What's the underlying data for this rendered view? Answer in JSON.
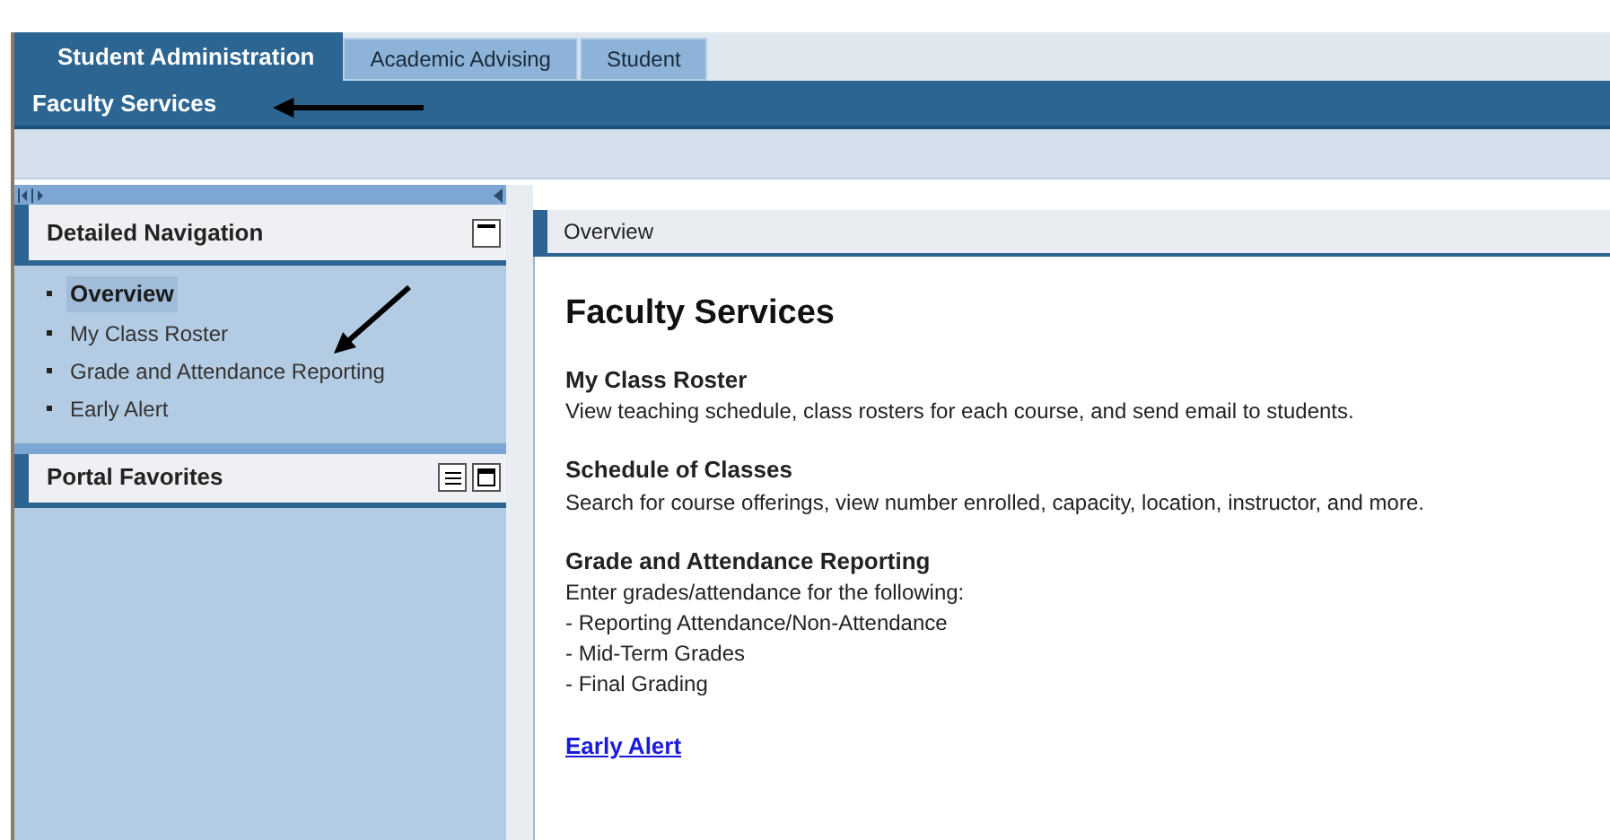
{
  "tabs": [
    {
      "label": "Student Administration",
      "selected": true
    },
    {
      "label": "Academic Advising",
      "selected": false
    },
    {
      "label": "Student",
      "selected": false
    }
  ],
  "subnav": "Faculty Services",
  "detailed_navigation": {
    "title": "Detailed Navigation",
    "items": [
      {
        "label": "Overview",
        "selected": true
      },
      {
        "label": "My Class Roster",
        "selected": false
      },
      {
        "label": "Grade and Attendance Reporting",
        "selected": false
      },
      {
        "label": "Early Alert",
        "selected": false
      }
    ]
  },
  "portal_favorites": {
    "title": "Portal Favorites"
  },
  "content": {
    "tab_title": "Overview",
    "heading": "Faculty Services",
    "sections": [
      {
        "title": "My Class Roster",
        "lines": [
          "View teaching schedule, class rosters for each course, and send email to students."
        ]
      },
      {
        "title": "Schedule of Classes",
        "lines": [
          "Search for course offerings, view number enrolled, capacity, location, instructor, and more."
        ]
      },
      {
        "title": "Grade and Attendance Reporting",
        "lines": [
          "Enter grades/attendance for the following:",
          "- Reporting Attendance/Non-Attendance",
          "- Mid-Term Grades",
          "- Final Grading"
        ]
      }
    ],
    "link": "Early Alert"
  }
}
